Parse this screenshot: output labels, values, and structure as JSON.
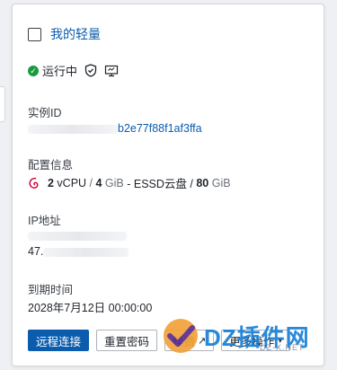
{
  "instance": {
    "name": "我的轻量",
    "status": "运行中"
  },
  "sections": {
    "id_label": "实例ID",
    "id_value": "b2e77f88f1af3ffa",
    "config_label": "配置信息",
    "config": {
      "cpu_num": "2",
      "cpu_unit": " vCPU",
      "sep1": " / ",
      "mem_num": "4",
      "mem_unit": " GiB",
      "disk_type": " - ESSD云盘 / ",
      "disk_num": "80",
      "disk_unit": " GiB"
    },
    "ip_label": "IP地址",
    "ip_public_prefix": "47.",
    "expire_label": "到期时间",
    "expire_value": "2028年7月12日 00:00:00"
  },
  "buttons": {
    "remote": "远程连接",
    "reset_pwd": "重置密码",
    "renew": "续费",
    "more": "更多操作"
  },
  "watermark": {
    "text": "DZ插件网",
    "sub": "DZ-X.NET"
  },
  "colors": {
    "primary": "#0b5cad",
    "running": "#1a9a3f",
    "debian": "#c70036"
  }
}
